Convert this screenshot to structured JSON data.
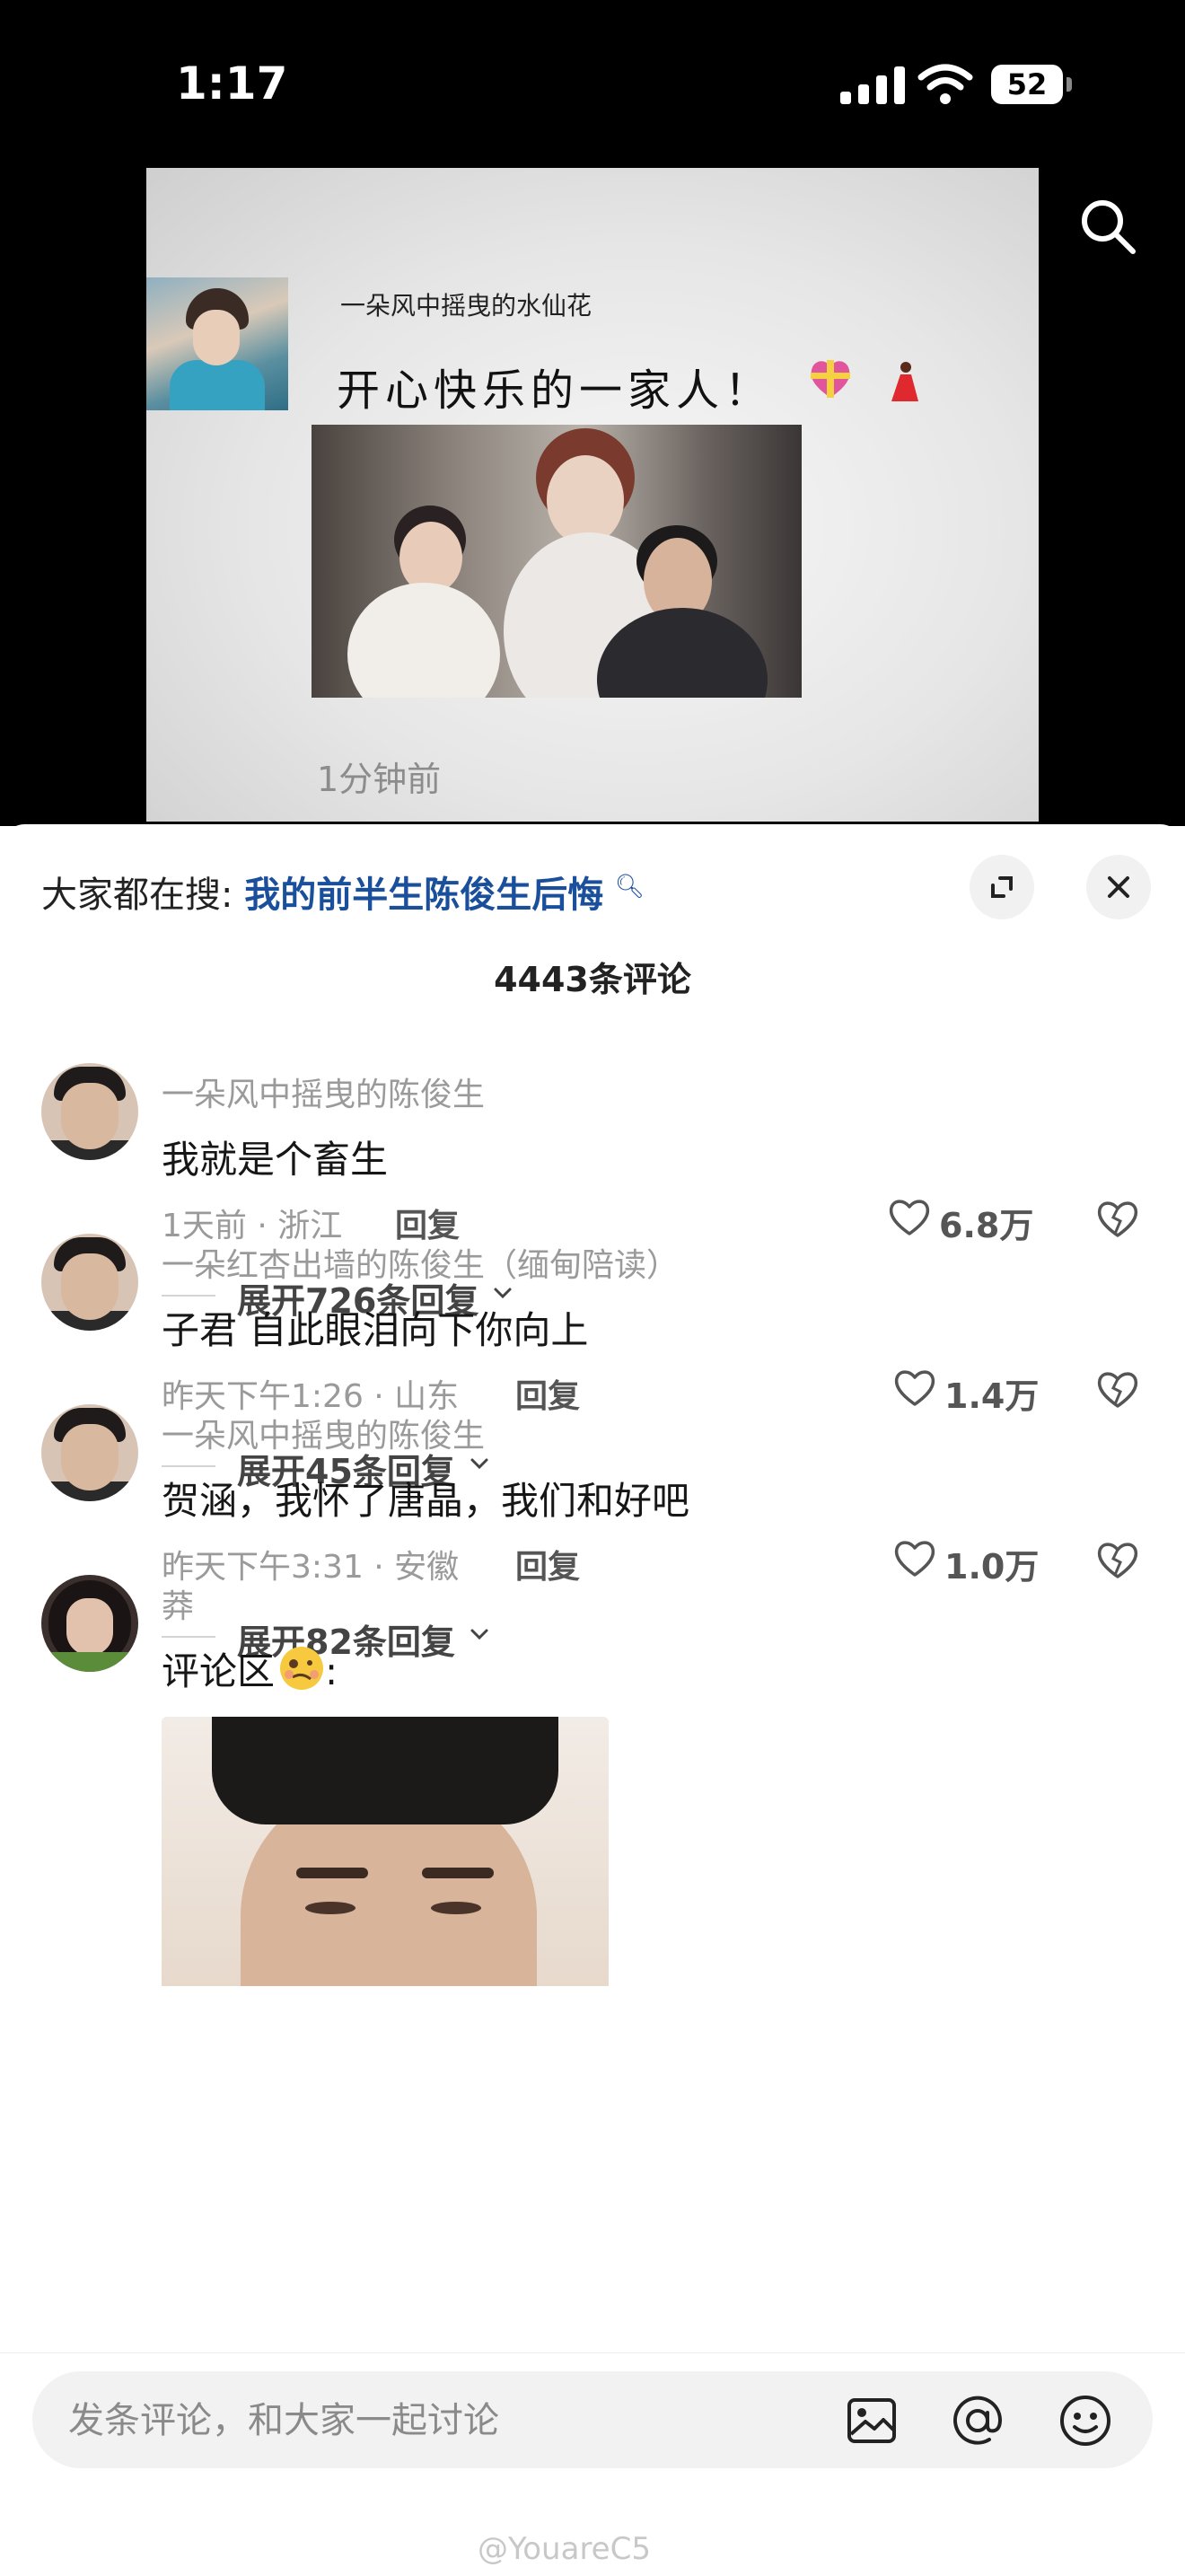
{
  "status_bar": {
    "time": "1:17",
    "battery": "52"
  },
  "post": {
    "author": "一朵风中摇曳的水仙花",
    "text": "开心快乐的一家人！",
    "time": "1分钟前"
  },
  "sheet": {
    "trending_prefix": "大家都在搜:",
    "trending_link": "我的前半生陈俊生后悔",
    "comment_count": "4443条评论"
  },
  "comments": [
    {
      "name": "一朵风中摇曳的陈俊生",
      "text": "我就是个畜生",
      "meta": "1天前 · 浙江",
      "reply": "回复",
      "likes": "6.8万",
      "expand": "展开726条回复"
    },
    {
      "name": "一朵红杏出墙的陈俊生（缅甸陪读）",
      "text": "子君 自此眼泪向下你向上",
      "meta": "昨天下午1:26 · 山东",
      "reply": "回复",
      "likes": "1.4万",
      "expand": "展开45条回复"
    },
    {
      "name": "一朵风中摇曳的陈俊生",
      "text": "贺涵，我怀了唐晶，我们和好吧",
      "meta": "昨天下午3:31 · 安徽",
      "reply": "回复",
      "likes": "1.0万",
      "expand": "展开82条回复"
    },
    {
      "name": "莽",
      "text": "评论区",
      "text_suffix": ":"
    }
  ],
  "input": {
    "placeholder": "发条评论，和大家一起讨论"
  },
  "watermark": "@YouareC5",
  "icons": [
    "search-icon",
    "expand-icon",
    "close-icon",
    "heart-icon",
    "dislike-icon",
    "chevron-down-icon",
    "image-icon",
    "at-icon",
    "emoji-icon"
  ]
}
